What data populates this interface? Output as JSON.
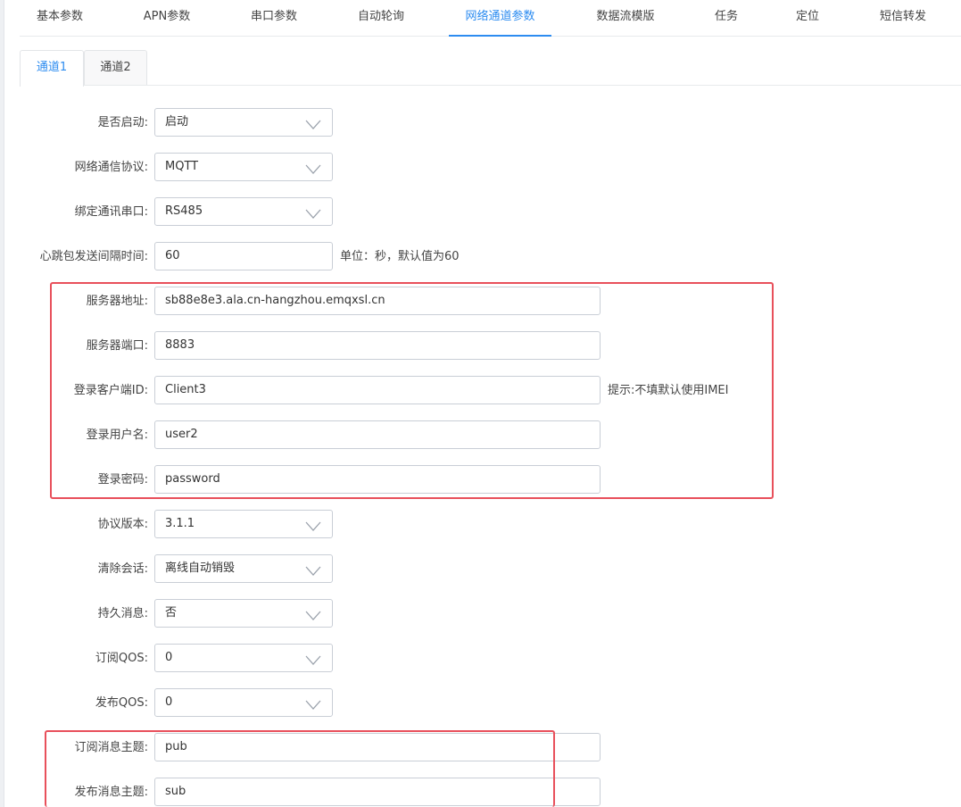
{
  "top_tabs": [
    {
      "label": "基本参数"
    },
    {
      "label": "APN参数"
    },
    {
      "label": "串口参数"
    },
    {
      "label": "自动轮询"
    },
    {
      "label": "网络通道参数"
    },
    {
      "label": "数据流模版"
    },
    {
      "label": "任务"
    },
    {
      "label": "定位"
    },
    {
      "label": "短信转发"
    }
  ],
  "active_top_tab": "网络通道参数",
  "sub_tabs": [
    {
      "label": "通道1"
    },
    {
      "label": "通道2"
    }
  ],
  "active_sub_tab": "通道1",
  "form": {
    "enabled": {
      "label": "是否启动:",
      "value": "启动"
    },
    "protocol": {
      "label": "网络通信协议:",
      "value": "MQTT"
    },
    "serial_port": {
      "label": "绑定通讯串口:",
      "value": "RS485"
    },
    "heartbeat": {
      "label": "心跳包发送间隔时间:",
      "value": "60",
      "hint": "单位：秒，默认值为60"
    },
    "server_address": {
      "label": "服务器地址:",
      "value": "sb88e8e3.ala.cn-hangzhou.emqxsl.cn"
    },
    "server_port": {
      "label": "服务器端口:",
      "value": "8883"
    },
    "client_id": {
      "label": "登录客户端ID:",
      "value": "Client3",
      "hint": "提示:不填默认使用IMEI"
    },
    "username": {
      "label": "登录用户名:",
      "value": "user2"
    },
    "password": {
      "label": "登录密码:",
      "value": "password"
    },
    "protocol_version": {
      "label": "协议版本:",
      "value": "3.1.1"
    },
    "clean_session": {
      "label": "清除会话:",
      "value": "离线自动销毁"
    },
    "retain": {
      "label": "持久消息:",
      "value": "否"
    },
    "sub_qos": {
      "label": "订阅QOS:",
      "value": "0"
    },
    "pub_qos": {
      "label": "发布QOS:",
      "value": "0"
    },
    "sub_topic": {
      "label": "订阅消息主题:",
      "value": "pub"
    },
    "pub_topic": {
      "label": "发布消息主题:",
      "value": "sub"
    }
  },
  "icons": {
    "select_arrow": "chevron-down-icon"
  },
  "colors": {
    "accent": "#2d8cf0",
    "highlight_box": "#e8505b",
    "input_border": "#c9ced6"
  }
}
